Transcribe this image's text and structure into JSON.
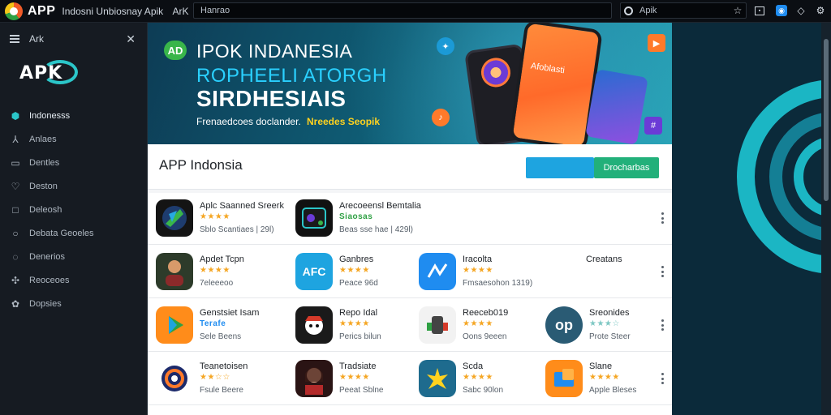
{
  "topbar": {
    "app_name": "APP",
    "window_title": "Indosni Unbiosnay Apik",
    "title_suffix": "ArK",
    "url": "Hanrao",
    "search_text": "Apik"
  },
  "sidebar": {
    "header_label": "Ark",
    "brand": "APK",
    "items": [
      {
        "label": "Indonesss",
        "icon": "shield-icon"
      },
      {
        "label": "Anlaes",
        "icon": "anchor-icon"
      },
      {
        "label": "Dentles",
        "icon": "document-icon"
      },
      {
        "label": "Deston",
        "icon": "heart-icon"
      },
      {
        "label": "Deleosh",
        "icon": "square-icon"
      },
      {
        "label": "Debata Geoeles",
        "icon": "circle-icon"
      },
      {
        "label": "Denerios",
        "icon": "globe-icon"
      },
      {
        "label": "Reoceoes",
        "icon": "puzzle-icon"
      },
      {
        "label": "Dopsies",
        "icon": "gear-icon"
      }
    ]
  },
  "banner": {
    "badge": "AD",
    "line1": "IPOK INDANESIA",
    "line2": "ROPHEELI ATORGH",
    "line3": "SIRDHESIAIS",
    "line4": "Frenaedcoes doclander.",
    "line5": "Nreedes Seopik",
    "phone_text": "Afoblasti"
  },
  "page": {
    "title": "APP Indonsia",
    "primary_button": "",
    "secondary_button": "Drocharbas"
  },
  "apps": [
    [
      {
        "name": "Aplc Saanned Sreerk",
        "rating": "★★★★",
        "meta": "Sblo Scantiaes  | 29l)",
        "icon": "prism-icon"
      },
      {
        "name": "Arecoeensl Bemtalia",
        "rating": "Siaosas",
        "meta": "Beas sse hae | 429l)",
        "icon": "game-icon"
      }
    ],
    [
      {
        "name": "Apdet Tcpn",
        "rating": "★★★★",
        "meta": "7eleeeoo",
        "icon": "avatar-icon"
      },
      {
        "name": "Ganbres",
        "rating": "★★★★",
        "meta": "Peace 96d",
        "icon": "afc-icon"
      },
      {
        "name": "Iracolta",
        "rating": "★★★★",
        "meta": "Fmsaesohon  1319)",
        "icon": "share-icon"
      },
      {
        "name": "Creatans",
        "rating": "",
        "meta": "",
        "icon": ""
      }
    ],
    [
      {
        "name": "Genstsiet Isam",
        "rating": "Terafe",
        "meta": "Sele Beens",
        "icon": "play-icon"
      },
      {
        "name": "Repo Idal",
        "rating": "★★★★",
        "meta": "Perics bilun",
        "icon": "pirate-icon"
      },
      {
        "name": "Reeceb019",
        "rating": "★★★★",
        "meta": "Oons 9eeen",
        "icon": "robot-icon"
      },
      {
        "name": "Sreonides",
        "rating": "★★★☆",
        "meta": "Prote Steer",
        "icon": "op-icon"
      }
    ],
    [
      {
        "name": "Teanetoisen",
        "rating": "★★☆☆",
        "meta": "Fsule Beere",
        "icon": "ring-icon"
      },
      {
        "name": "Tradsiate",
        "rating": "★★★★",
        "meta": "Peeat Sblne",
        "icon": "portrait-icon"
      },
      {
        "name": "Scda",
        "rating": "★★★★",
        "meta": "Sabc 90lon",
        "icon": "splash-icon"
      },
      {
        "name": "Slane",
        "rating": "★★★★",
        "meta": "Apple Bleses",
        "icon": "folder-icon"
      }
    ]
  ],
  "colors": {
    "accent_teal": "#2bc6c9",
    "button_blue": "#1ea4e0",
    "button_green": "#22b07a",
    "star": "#f5a623"
  }
}
